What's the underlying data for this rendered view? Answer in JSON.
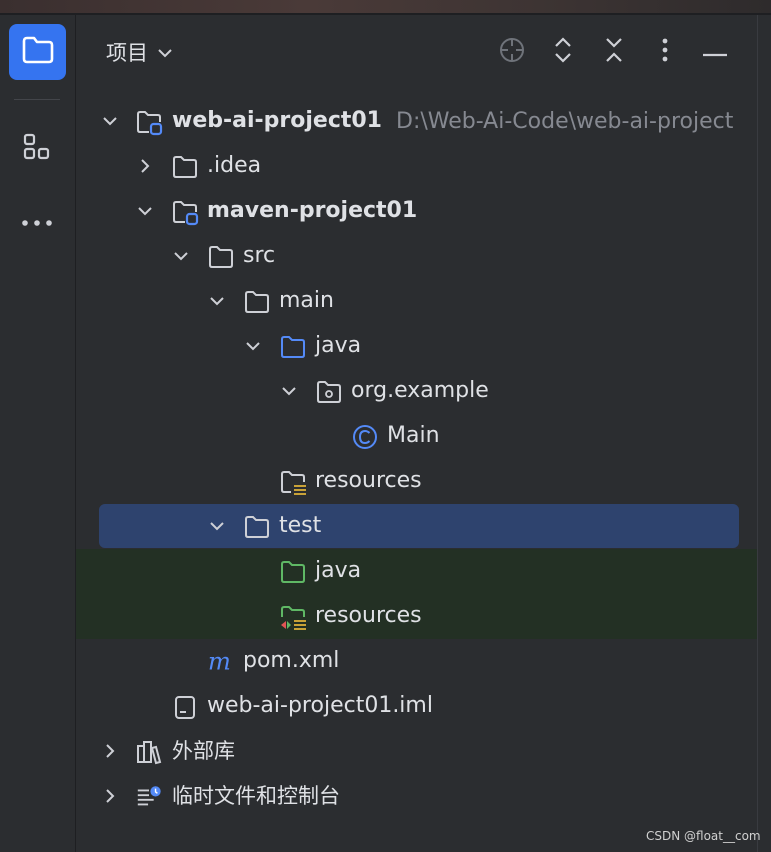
{
  "panel": {
    "title": "项目",
    "header_icons": [
      "crosshair-icon",
      "expand-all-icon",
      "collapse-all-icon",
      "more-vertical-icon",
      "minimize-icon"
    ]
  },
  "activity_bar": {
    "items": [
      "project-folder-icon",
      "structure-icon",
      "more-horizontal-icon"
    ]
  },
  "tree": {
    "root": {
      "label": "web-ai-project01",
      "path": "D:\\Web-Ai-Code\\web-ai-project"
    },
    "idea": "idea_placeholder",
    "items": [
      ".idea",
      "maven-project01",
      "src",
      "main",
      "java",
      "org.example",
      "Main",
      "resources",
      "test",
      "java",
      "resources",
      "pom.xml",
      "web-ai-project01.iml",
      "外部库",
      "临时文件和控制台"
    ]
  },
  "watermark": "CSDN @float__com",
  "colors": {
    "background": "#2b2d30",
    "selection": "#2e436e",
    "test_sources": "#233024",
    "accent": "#3574f0",
    "folder_blue": "#548af7",
    "folder_green": "#5fb865"
  }
}
